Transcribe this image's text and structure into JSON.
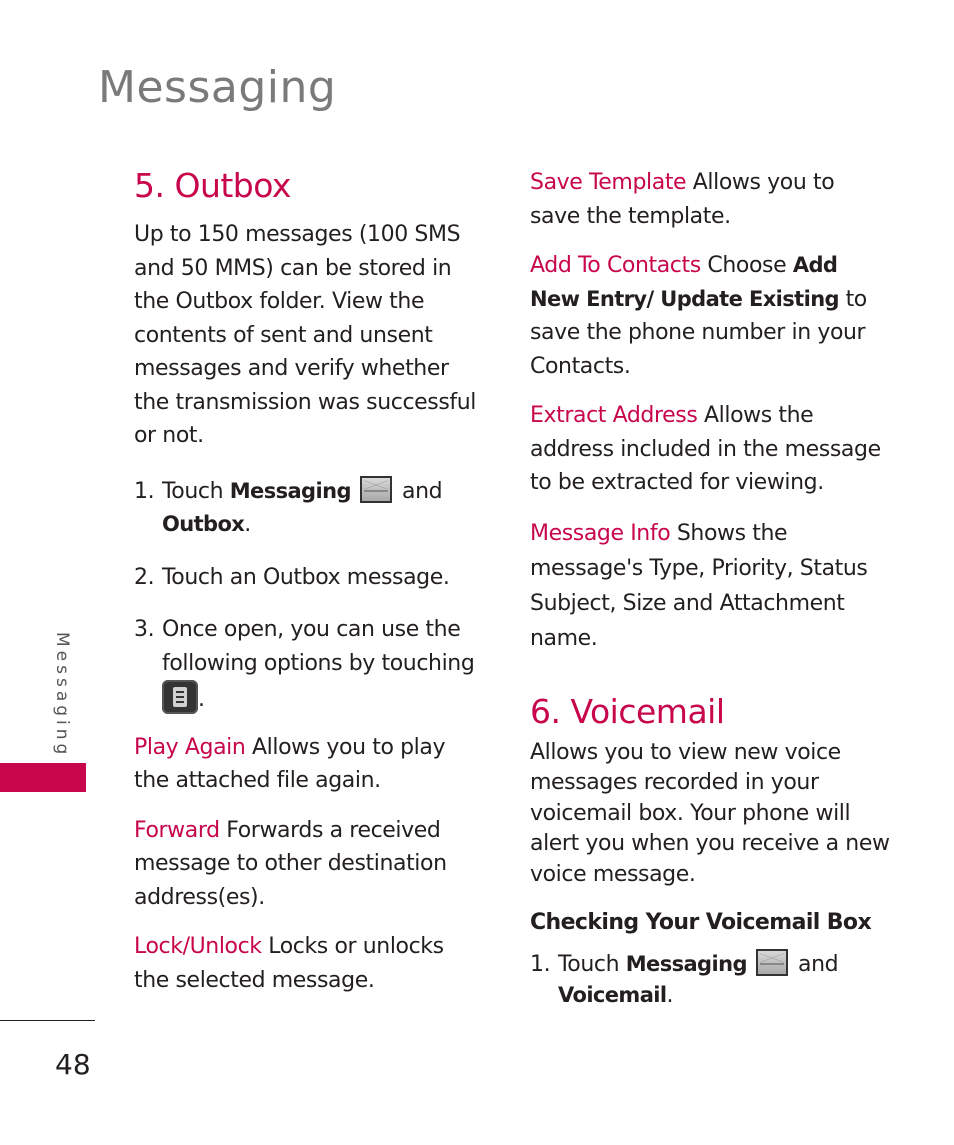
{
  "page": {
    "title": "Messaging",
    "side_label": "Messaging",
    "page_number": "48",
    "accent_color": "#c8064c"
  },
  "outbox": {
    "title": "5. Outbox",
    "intro": "Up to 150 messages (100 SMS and 50 MMS) can be stored in the Outbox folder. View the contents of sent and unsent messages and verify whether the transmission was successful or not.",
    "steps": [
      {
        "num": "1.",
        "pre": "Touch ",
        "bold1": "Messaging",
        "icon": "messaging-envelope-icon",
        "mid": " and ",
        "bold2": "Outbox",
        "post": "."
      },
      {
        "num": "2.",
        "text": "Touch an Outbox message."
      },
      {
        "num": "3.",
        "text": "Once open, you can use the following options by touching",
        "icon": "menu-icon",
        "post": "."
      }
    ],
    "options": [
      {
        "term": "Play Again",
        "desc": " Allows you to play the attached file again."
      },
      {
        "term": "Forward",
        "desc": " Forwards a received message to other destination address(es)."
      },
      {
        "term": "Lock/Unlock",
        "desc": " Locks or unlocks the selected message."
      },
      {
        "term": "Save Template",
        "desc": " Allows you to save the template."
      },
      {
        "term": "Add To Contacts",
        "desc_pre": " Choose ",
        "bold": "Add New Entry/ Update Existing",
        "desc_post": " to save the phone number in your Contacts."
      },
      {
        "term": "Extract Address",
        "desc": " Allows the address included in the message to be extracted for viewing."
      },
      {
        "term": "Message Info",
        "desc": " Shows the message's Type, Priority, Status Subject, Size and Attachment name."
      }
    ]
  },
  "voicemail": {
    "title": "6. Voicemail",
    "intro": "Allows you to view new voice messages recorded in your voicemail box. Your phone will alert you when you receive a new voice message.",
    "subheading": "Checking Your Voicemail Box",
    "steps": [
      {
        "num": "1.",
        "pre": "Touch ",
        "bold1": "Messaging",
        "icon": "messaging-envelope-icon",
        "mid": " and ",
        "bold2": "Voicemail",
        "post": "."
      }
    ]
  }
}
